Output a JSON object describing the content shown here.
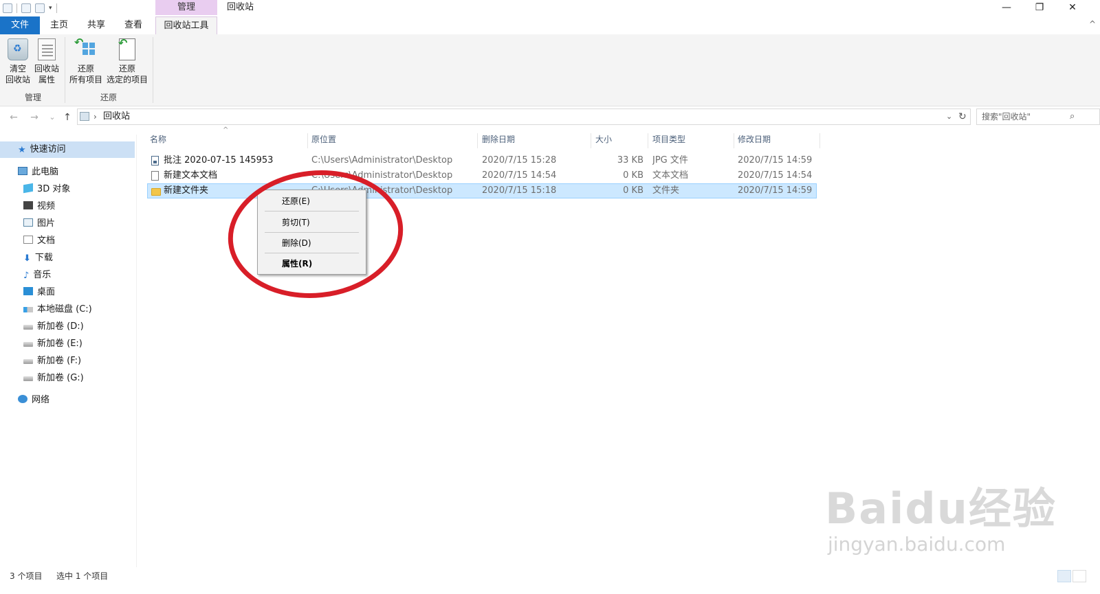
{
  "titlebar": {
    "manage_tab": "管理",
    "title": "回收站",
    "minimize": "—",
    "restore": "❐",
    "close": "✕"
  },
  "tabs": {
    "file": "文件",
    "home": "主页",
    "share": "共享",
    "view": "查看",
    "tools": "回收站工具",
    "collapse": "^"
  },
  "ribbon": {
    "buttons": [
      {
        "line1": "清空",
        "line2": "回收站",
        "icon": "recycle-bin-icon"
      },
      {
        "line1": "回收站",
        "line2": "属性",
        "icon": "properties-icon"
      },
      {
        "line1": "还原",
        "line2": "所有项目",
        "icon": "restore-all-icon"
      },
      {
        "line1": "还原",
        "line2": "选定的项目",
        "icon": "restore-selected-icon"
      }
    ],
    "groups": [
      "管理",
      "还原"
    ]
  },
  "nav": {
    "back": "←",
    "forward": "→",
    "recent": "⌄",
    "up": "↑"
  },
  "address": {
    "chevron": "›",
    "path": "回收站",
    "dropdown": "⌄",
    "refresh": "↻"
  },
  "search": {
    "placeholder": "搜索\"回收站\"",
    "icon": "⌕"
  },
  "sidebar": {
    "quick_access": "快速访问",
    "this_pc": "此电脑",
    "items": [
      "3D 对象",
      "视频",
      "图片",
      "文档",
      "下载",
      "音乐",
      "桌面",
      "本地磁盘 (C:)",
      "新加卷 (D:)",
      "新加卷 (E:)",
      "新加卷 (F:)",
      "新加卷 (G:)"
    ],
    "network": "网络"
  },
  "columns": [
    "名称",
    "原位置",
    "删除日期",
    "大小",
    "项目类型",
    "修改日期"
  ],
  "sort_indicator": "^",
  "rows": [
    {
      "name": "批注 2020-07-15 145953",
      "location": "C:\\Users\\Administrator\\Desktop",
      "deleted": "2020/7/15 15:28",
      "size": "33 KB",
      "type": "JPG 文件",
      "modified": "2020/7/15 14:59",
      "icon": "image-file-icon"
    },
    {
      "name": "新建文本文档",
      "location": "C:\\Users\\Administrator\\Desktop",
      "deleted": "2020/7/15 14:54",
      "size": "0 KB",
      "type": "文本文档",
      "modified": "2020/7/15 14:54",
      "icon": "text-file-icon"
    },
    {
      "name": "新建文件夹",
      "location": "C:\\Users\\Administrator\\Desktop",
      "deleted": "2020/7/15 15:18",
      "size": "0 KB",
      "type": "文件夹",
      "modified": "2020/7/15 14:59",
      "icon": "folder-icon",
      "selected": true
    }
  ],
  "context_menu": [
    "还原(E)",
    "剪切(T)",
    "删除(D)",
    "属性(R)"
  ],
  "status": {
    "count": "3 个项目",
    "selection": "选中 1 个项目"
  },
  "watermark": {
    "main": "Baidu经验",
    "sub": "jingyan.baidu.com"
  },
  "colors": {
    "file_tab": "#1a73c8",
    "manage_tab": "#e9cdf0",
    "selection": "#cce8ff",
    "annotation": "#d81e28"
  }
}
